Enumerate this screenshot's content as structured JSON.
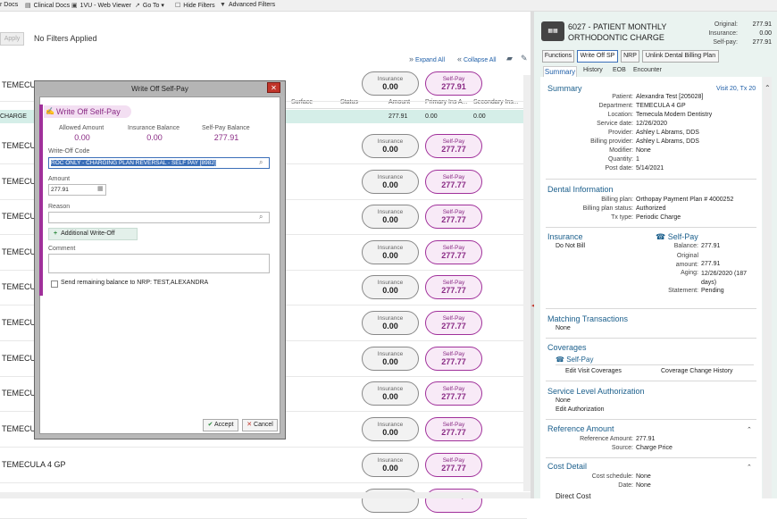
{
  "toolbar": {
    "items": [
      {
        "label": "r Docs",
        "icon": ""
      },
      {
        "label": "Clinical Docs",
        "icon": "docs-icon"
      },
      {
        "label": "1VU - Web Viewer",
        "icon": "viewer-icon"
      },
      {
        "label": "Go To",
        "icon": "goto-icon"
      },
      {
        "label": "Hide Filters",
        "icon": "checkbox-icon"
      },
      {
        "label": "Advanced Filters",
        "icon": "filter-icon"
      }
    ]
  },
  "filters": {
    "apply_label": "Apply",
    "status": "No Filters Applied"
  },
  "list": {
    "expand_all": "Expand All",
    "collapse_all": "Collapse All",
    "columns": [
      "Surface",
      "Status",
      "Amount",
      "Primary Ins A...",
      "Secondary Ins..."
    ],
    "charge_row": {
      "label": "CHARGE",
      "amount": "277.91",
      "primary": "0.00",
      "secondary": "0.00"
    },
    "rows": [
      {
        "label": "TEMECULA",
        "ins_label": "Insurance",
        "ins_val": "0.00",
        "sp_label": "Self-Pay",
        "sp_val": "277.91"
      },
      {
        "label": "TEMECUL",
        "ins_label": "Insurance",
        "ins_val": "0.00",
        "sp_label": "Self-Pay",
        "sp_val": "277.77"
      },
      {
        "label": "TEMECUL",
        "ins_label": "Insurance",
        "ins_val": "0.00",
        "sp_label": "Self-Pay",
        "sp_val": "277.77"
      },
      {
        "label": "TEMECUL",
        "ins_label": "Insurance",
        "ins_val": "0.00",
        "sp_label": "Self-Pay",
        "sp_val": "277.77"
      },
      {
        "label": "TEMECUL",
        "ins_label": "Insurance",
        "ins_val": "0.00",
        "sp_label": "Self-Pay",
        "sp_val": "277.77"
      },
      {
        "label": "TEMECUL",
        "ins_label": "Insurance",
        "ins_val": "0.00",
        "sp_label": "Self-Pay",
        "sp_val": "277.77"
      },
      {
        "label": "TEMECUL",
        "ins_label": "Insurance",
        "ins_val": "0.00",
        "sp_label": "Self-Pay",
        "sp_val": "277.77"
      },
      {
        "label": "TEMECUL",
        "ins_label": "Insurance",
        "ins_val": "0.00",
        "sp_label": "Self-Pay",
        "sp_val": "277.77"
      },
      {
        "label": "TEMECUL",
        "ins_label": "Insurance",
        "ins_val": "0.00",
        "sp_label": "Self-Pay",
        "sp_val": "277.77"
      },
      {
        "label": "TEMECUL",
        "ins_label": "Insurance",
        "ins_val": "0.00",
        "sp_label": "Self-Pay",
        "sp_val": "277.77"
      },
      {
        "label": "TEMECULA 4 GP",
        "ins_label": "Insurance",
        "ins_val": "0.00",
        "sp_label": "Self-Pay",
        "sp_val": "277.77"
      },
      {
        "label": "",
        "ins_label": "Insurance",
        "ins_val": "",
        "sp_label": "Self-Pay",
        "sp_val": ""
      }
    ]
  },
  "dialog": {
    "window_title": "Write Off Self-Pay",
    "header": "Write Off Self-Pay",
    "allowed_label": "Allowed Amount",
    "allowed_val": "0.00",
    "insbal_label": "Insurance Balance",
    "insbal_val": "0.00",
    "spbal_label": "Self-Pay Balance",
    "spbal_val": "277.91",
    "code_label": "Write-Off Code",
    "code_val": "ROC ONLY - CHARGING PLAN REVERSAL - SELF PAY [8982]",
    "amount_label": "Amount",
    "amount_val": "277.91",
    "reason_label": "Reason",
    "add_label": "Additional Write-Off",
    "comment_label": "Comment",
    "checkbox_label": "Send remaining balance to NRP: TEST,ALEXANDRA",
    "accept": "Accept",
    "cancel": "Cancel"
  },
  "charge": {
    "title": "6027 - PATIENT MONTHLY ORTHODONTIC CHARGE",
    "original_label": "Original:",
    "original_val": "277.91",
    "insurance_label": "Insurance:",
    "insurance_val": "0.00",
    "selfpay_label": "Self-pay:",
    "selfpay_val": "277.91",
    "buttons": [
      "Functions",
      "Write Off SP",
      "NRP",
      "Unlink Dental Billing Plan"
    ],
    "tabs": [
      "Summary",
      "History",
      "EOB",
      "Encounter"
    ]
  },
  "summary": {
    "title": "Summary",
    "visit": "Visit 20, Tx 20",
    "fields": [
      {
        "k": "Patient:",
        "v": "Alexandra Test [205028]"
      },
      {
        "k": "Department:",
        "v": "TEMECULA 4 GP"
      },
      {
        "k": "Location:",
        "v": "Temecula Modern Dentistry"
      },
      {
        "k": "Service date:",
        "v": "12/26/2020"
      },
      {
        "k": "Provider:",
        "v": "Ashley L Abrams, DDS"
      },
      {
        "k": "Billing provider:",
        "v": "Ashley L Abrams, DDS"
      },
      {
        "k": "Modifier:",
        "v": "None"
      },
      {
        "k": "Quantity:",
        "v": "1"
      },
      {
        "k": "Post date:",
        "v": "5/14/2021"
      }
    ]
  },
  "dental": {
    "title": "Dental Information",
    "plan_label": "Billing plan:",
    "plan_val": "Orthopay Payment Plan # 4000252",
    "status_label": "Billing plan status:",
    "status_val": "Authorized",
    "tx_label": "Tx type:",
    "tx_val": "Periodic Charge"
  },
  "insurance": {
    "title": "Insurance",
    "val": "Do Not Bill",
    "sp_title": "Self-Pay",
    "balance_label": "Balance:",
    "balance_val": "277.91",
    "orig_label": "Original amount:",
    "orig_val": "277.91",
    "aging_label": "Aging:",
    "aging_val": "12/26/2020 (187 days)",
    "statement_label": "Statement:",
    "statement_val": "Pending"
  },
  "matching": {
    "title": "Matching Transactions",
    "val": "None"
  },
  "coverages": {
    "title": "Coverages",
    "item": "Self-Pay",
    "edit": "Edit Visit Coverages",
    "history": "Coverage Change History"
  },
  "sla": {
    "title": "Service Level Authorization",
    "val": "None",
    "edit": "Edit Authorization"
  },
  "reference": {
    "title": "Reference Amount",
    "amt_label": "Reference Amount:",
    "amt_val": "277.91",
    "src_label": "Source:",
    "src_val": "Charge Price"
  },
  "cost": {
    "title": "Cost Detail",
    "sched_label": "Cost schedule:",
    "sched_val": "None",
    "date_label": "Date:",
    "date_val": "None",
    "direct": "Direct Cost"
  }
}
